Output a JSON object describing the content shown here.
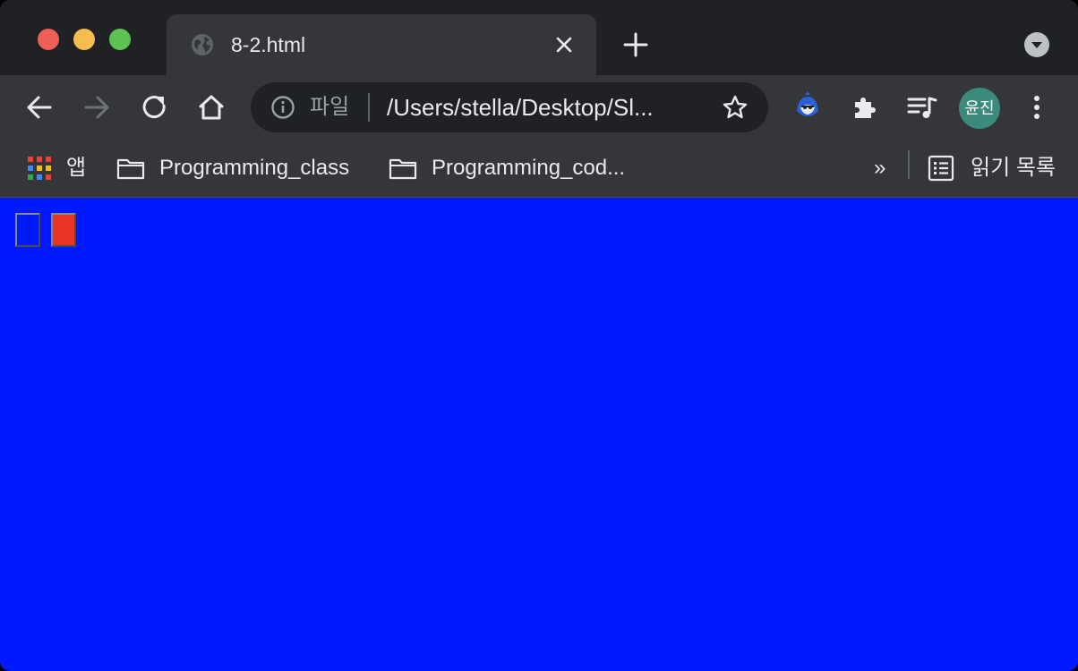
{
  "window": {
    "title": "8-2.html"
  },
  "tab": {
    "title": "8-2.html",
    "close_label": "✕"
  },
  "toolbar": {
    "omnibox_chip": "파일",
    "url": "/Users/stella/Desktop/Sl...",
    "avatar_text": "윤진"
  },
  "bookmarks": {
    "apps_label": "앱",
    "items": [
      {
        "label": "Programming_class"
      },
      {
        "label": "Programming_cod..."
      }
    ],
    "overflow": "»",
    "reading_list": "읽기 목록"
  },
  "page": {
    "background": "#0019ff",
    "buttons": [
      {
        "color": "#0019ff"
      },
      {
        "color": "#e93323"
      }
    ]
  },
  "colors": {
    "chrome_dark": "#202124",
    "chrome_toolbar": "#35363a",
    "avatar": "#3c8a7b"
  }
}
